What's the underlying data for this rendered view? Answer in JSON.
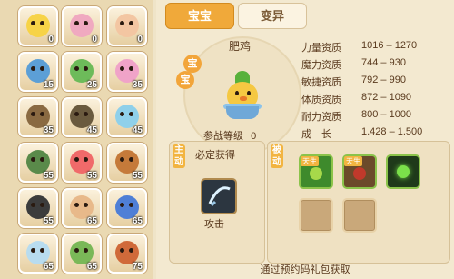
{
  "tabs": {
    "active": "宝宝",
    "inactive": "变异"
  },
  "pet": {
    "name": "肥鸡",
    "seal_top": "宝",
    "seal_bottom": "宝",
    "level_label": "参战等级",
    "level": "0"
  },
  "stats": [
    {
      "label": "力量资质",
      "value": "1016 – 1270"
    },
    {
      "label": "魔力资质",
      "value": "744 – 930"
    },
    {
      "label": "敏捷资质",
      "value": "792 – 990"
    },
    {
      "label": "体质资质",
      "value": "872 – 1090"
    },
    {
      "label": "耐力资质",
      "value": "800 – 1000"
    },
    {
      "label": "成　长",
      "value": "1.428 – 1.500"
    }
  ],
  "active_box": {
    "tag": "主动",
    "title": "必定获得",
    "skill_name": "攻击"
  },
  "passive_box": {
    "tag": "被动",
    "badge1": "天生",
    "badge2": "天生"
  },
  "footer": "通过预约码礼包获取",
  "grid": [
    {
      "level": "0",
      "color": "#f7d347"
    },
    {
      "level": "0",
      "color": "#f0a9c0"
    },
    {
      "level": "0",
      "color": "#f3c6a2"
    },
    {
      "level": "15",
      "color": "#5c9fd6"
    },
    {
      "level": "25",
      "color": "#6dbb5a"
    },
    {
      "level": "35",
      "color": "#f0a3c8"
    },
    {
      "level": "35",
      "color": "#8a6a42"
    },
    {
      "level": "45",
      "color": "#6a5a3e"
    },
    {
      "level": "45",
      "color": "#8fd0ea"
    },
    {
      "level": "55",
      "color": "#5a8a4a"
    },
    {
      "level": "55",
      "color": "#f06a6a"
    },
    {
      "level": "55",
      "color": "#c57a3a"
    },
    {
      "level": "55",
      "color": "#3c3c3c"
    },
    {
      "level": "65",
      "color": "#e8b98a"
    },
    {
      "level": "65",
      "color": "#4f7fd6"
    },
    {
      "level": "65",
      "color": "#b8dcef"
    },
    {
      "level": "65",
      "color": "#7ab858"
    },
    {
      "level": "75",
      "color": "#d06a3a"
    }
  ]
}
